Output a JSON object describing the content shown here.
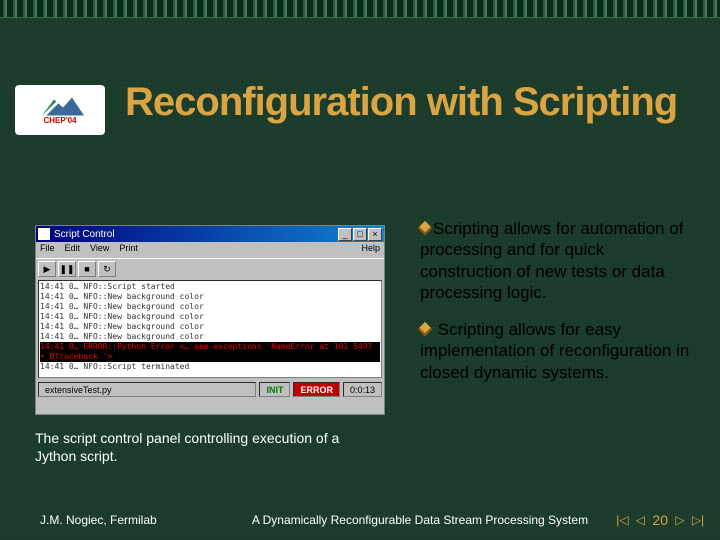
{
  "logo": {
    "label": "CHEP'04"
  },
  "title": "Reconfiguration with Scripting",
  "panel": {
    "window_title": "Script Control",
    "menu": {
      "file": "File",
      "edit": "Edit",
      "view": "View",
      "print": "Print",
      "help": "Help"
    },
    "log": {
      "l1": "14:41 0… NFO::Script started",
      "l2": "14:41 0… NFO::New background color",
      "l3": "14:41 0… NFO::New background color",
      "l4": "14:41 0… NFO::New background color",
      "l5": "14:41 0… NFO::New background color",
      "l6": "14:41 0… NFO::New background color",
      "l7": "14:41 0… ERROR::Python Error <… see exceptions 'NameError at 101 5497 • DTraceback '>",
      "l8": "14:41 0… NFO::Script terminated"
    },
    "status": {
      "file": "extensiveTest.py",
      "init": "INIT",
      "error": "ERROR",
      "time": "0:0:13"
    }
  },
  "caption": "The script control panel controlling execution of a Jython script.",
  "bullets": {
    "b1": "Scripting allows for automation of processing and for quick construction of new tests or data processing logic.",
    "b2": "Scripting allows for easy implementation of reconfiguration in closed dynamic systems."
  },
  "footer": {
    "author": "J.M. Nogiec, Fermilab",
    "center": "A Dynamically Reconfigurable Data Stream Processing System",
    "page": "20"
  }
}
